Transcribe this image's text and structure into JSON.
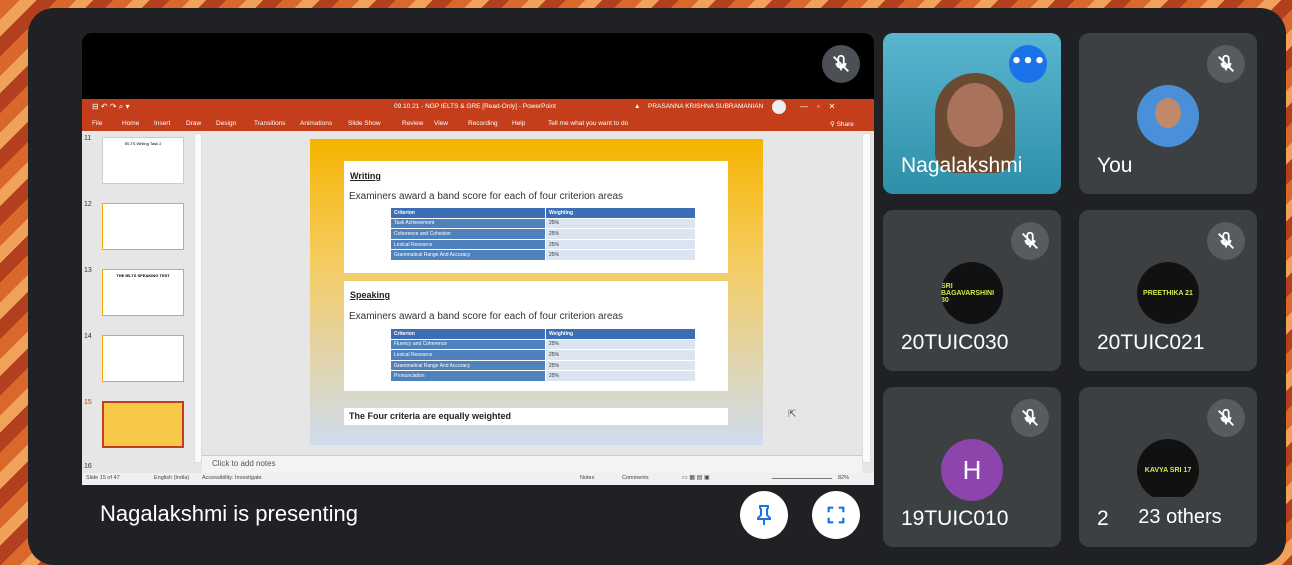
{
  "presentation": {
    "banner_text": "Nagalakshmi is presenting",
    "window_title": "09.10.21 - NGP IELTS & GRE [Read-Only] - PowerPoint",
    "warning_user": "PRASANNA KRISHNA SUBRAMANIAN",
    "ribbon_tabs": [
      "File",
      "Home",
      "Insert",
      "Draw",
      "Design",
      "Transitions",
      "Animations",
      "Slide Show",
      "Review",
      "View",
      "Recording",
      "Help",
      "Tell me what you want to do"
    ],
    "share_label": "Share",
    "thumb_numbers": [
      "11",
      "12",
      "13",
      "14",
      "15",
      "16"
    ],
    "thumb_titles": [
      "IELTS Writing Task 2",
      "",
      "THE IELTS SPEAKING TEST",
      "",
      ""
    ],
    "click_to_add_notes": "Click to add notes",
    "status_left": [
      "Slide 15 of 47",
      "English (India)",
      "Accessibility: Investigate"
    ],
    "status_right": [
      "Notes",
      "Comments",
      "82%"
    ]
  },
  "slide": {
    "writing": {
      "heading": "Writing",
      "subtext": "Examiners award a band score for each of four criterion areas",
      "header": [
        "Criterion",
        "Weighting"
      ],
      "rows": [
        [
          "Task Achievement",
          "25%"
        ],
        [
          "Coherence and Cohesion",
          "25%"
        ],
        [
          "Lexical Resource",
          "25%"
        ],
        [
          "Grammatical Range And Accuracy",
          "25%"
        ]
      ]
    },
    "speaking": {
      "heading": "Speaking",
      "subtext": "Examiners award a band score for each of four criterion areas",
      "header": [
        "Criterion",
        "Weighting"
      ],
      "rows": [
        [
          "Fluency and Coherence",
          "25%"
        ],
        [
          "Lexical Resource",
          "25%"
        ],
        [
          "Grammatical Range And Accuracy",
          "25%"
        ],
        [
          "Pronunciation",
          "25%"
        ]
      ]
    },
    "footer": "The Four criteria are equally weighted"
  },
  "participants": [
    {
      "name": "Nagalakshmi",
      "muted": false
    },
    {
      "name": "You",
      "muted": true
    },
    {
      "name": "20TUIC030",
      "avatar_text": "SRI BAGAVARSHINI 30",
      "muted": true
    },
    {
      "name": "20TUIC021",
      "avatar_text": "PREETHIKA 21",
      "muted": true
    },
    {
      "name": "19TUIC010",
      "avatar_letter": "H",
      "muted": true
    },
    {
      "name": "2",
      "avatar_text": "KAVYA SRI 17",
      "muted": true
    }
  ],
  "others_label": "23 others",
  "colors": {
    "meet_bg": "#202124",
    "tile_bg": "#3c4043",
    "ppt_ribbon": "#c43e1c",
    "h_avatar": "#8e44ad"
  }
}
